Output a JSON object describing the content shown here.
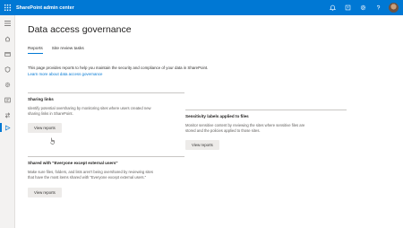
{
  "header": {
    "app_title": "SharePoint admin center",
    "icons": [
      "waffle-icon",
      "bell-icon",
      "help-icon",
      "settings-icon",
      "question-icon"
    ]
  },
  "nav": {
    "icons": [
      "menu-icon",
      "home-icon",
      "sites-icon",
      "policies-icon",
      "settings-icon",
      "contentservices-icon",
      "migration-icon",
      "reports-icon"
    ]
  },
  "page": {
    "title": "Data access governance",
    "tabs": [
      {
        "label": "Reports",
        "active": true
      },
      {
        "label": "Site review tasks",
        "active": false
      }
    ],
    "intro_line1": "This page provides reports to help you maintain the security and compliance of your data in SharePoint.",
    "intro_link": "Learn more about data access governance"
  },
  "sections": {
    "sharing": {
      "title": "Sharing links",
      "desc_line1": "Identify potential oversharing by monitoring sites where users created new",
      "desc_line2": "sharing links in SharePoint.",
      "button": "View reports"
    },
    "sensitivity": {
      "title": "Sensitivity labels applied to files",
      "desc_line1": "Monitor sensitive content by reviewing the sites where sensitive files are",
      "desc_line2": "stored and the policies applied to those sites.",
      "button": "View reports"
    },
    "shared_eeeu": {
      "title": "Shared with \"Everyone except external users\"",
      "desc_line1": "Make sure files, folders, and lists aren't being overshared by reviewing sites",
      "desc_line2": "that have the most items shared with \"Everyone except external users.\"",
      "button": "View reports"
    }
  },
  "colors": {
    "brand": "#0078d4",
    "button_bg": "#edebe9"
  }
}
